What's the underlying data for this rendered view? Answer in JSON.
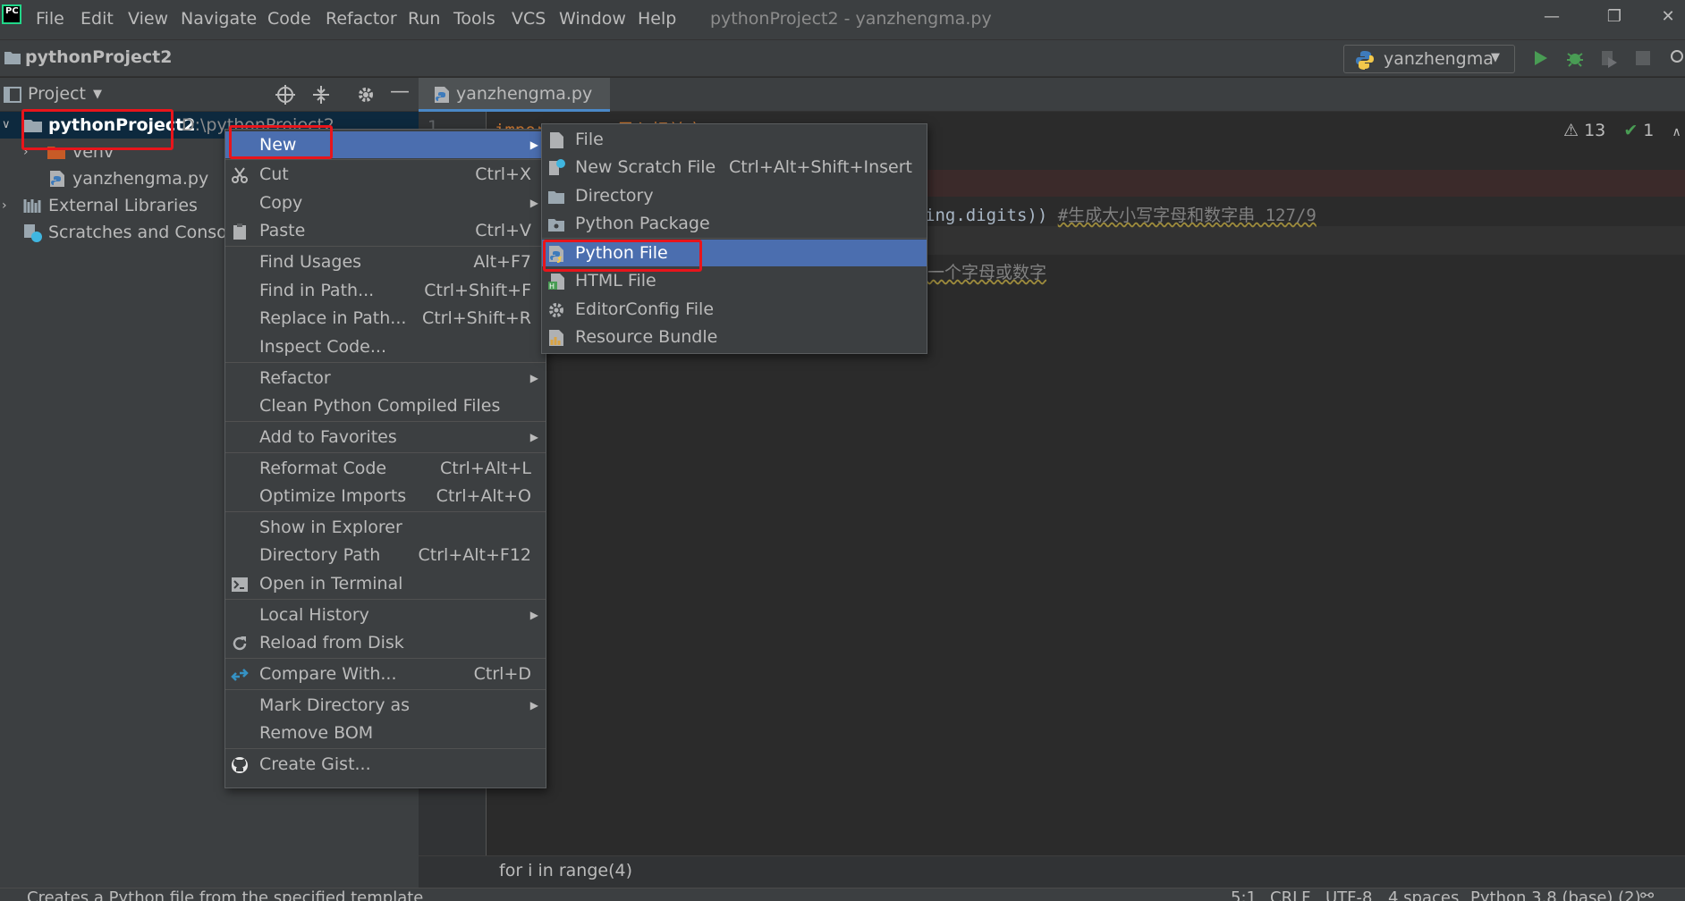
{
  "app": {
    "logo_text": "PC",
    "menu": [
      "File",
      "Edit",
      "View",
      "Navigate",
      "Code",
      "Refactor",
      "Run",
      "Tools",
      "VCS",
      "Window",
      "Help"
    ],
    "window_title": "pythonProject2 - yanzhengma.py"
  },
  "navbar": {
    "project": "pythonProject2",
    "run_config": "yanzhengma"
  },
  "project_panel": {
    "title": "Project",
    "tree": [
      {
        "label": "pythonProject2",
        "path": "D:\\pythonProject2"
      },
      {
        "label": "venv"
      },
      {
        "label": "yanzhengma.py"
      },
      {
        "label": "External Libraries"
      },
      {
        "label": "Scratches and Consoles"
      }
    ]
  },
  "editor": {
    "tab": "yanzhengma.py",
    "line_number": "1",
    "warnings": "13",
    "checks": "1",
    "line1": "import  ...  #导入相关库",
    "line3_code": "ing.digits)) ",
    "line3_comment": "#生成大小写字母和数字串  127/9",
    "line5_comment": "一个字母或数字",
    "breadcrumb": "for i in range(4)"
  },
  "context_menu": {
    "items": [
      {
        "label": "New",
        "shortcut": "",
        "submenu": true,
        "icon": ""
      },
      {
        "label": "Cut",
        "shortcut": "Ctrl+X",
        "icon": "scissors-icon"
      },
      {
        "label": "Copy",
        "shortcut": "",
        "submenu": true,
        "icon": ""
      },
      {
        "label": "Paste",
        "shortcut": "Ctrl+V",
        "icon": "clipboard-icon"
      },
      {
        "label": "Find Usages",
        "shortcut": "Alt+F7"
      },
      {
        "label": "Find in Path...",
        "shortcut": "Ctrl+Shift+F"
      },
      {
        "label": "Replace in Path...",
        "shortcut": "Ctrl+Shift+R"
      },
      {
        "label": "Inspect Code...",
        "shortcut": ""
      },
      {
        "label": "Refactor",
        "shortcut": "",
        "submenu": true
      },
      {
        "label": "Clean Python Compiled Files",
        "shortcut": ""
      },
      {
        "label": "Add to Favorites",
        "shortcut": "",
        "submenu": true
      },
      {
        "label": "Reformat Code",
        "shortcut": "Ctrl+Alt+L"
      },
      {
        "label": "Optimize Imports",
        "shortcut": "Ctrl+Alt+O"
      },
      {
        "label": "Show in Explorer",
        "shortcut": ""
      },
      {
        "label": "Directory Path",
        "shortcut": "Ctrl+Alt+F12"
      },
      {
        "label": "Open in Terminal",
        "shortcut": "",
        "icon": "terminal-icon"
      },
      {
        "label": "Local History",
        "shortcut": "",
        "submenu": true
      },
      {
        "label": "Reload from Disk",
        "shortcut": "",
        "icon": "reload-icon"
      },
      {
        "label": "Compare With...",
        "shortcut": "Ctrl+D",
        "icon": "compare-icon"
      },
      {
        "label": "Mark Directory as",
        "shortcut": "",
        "submenu": true
      },
      {
        "label": "Remove BOM",
        "shortcut": ""
      },
      {
        "label": "Create Gist...",
        "shortcut": "",
        "icon": "github-icon"
      }
    ]
  },
  "new_submenu": {
    "items": [
      {
        "label": "File",
        "shortcut": ""
      },
      {
        "label": "New Scratch File",
        "shortcut": "Ctrl+Alt+Shift+Insert"
      },
      {
        "label": "Directory",
        "shortcut": ""
      },
      {
        "label": "Python Package",
        "shortcut": ""
      },
      {
        "label": "Python File",
        "shortcut": "",
        "selected": true
      },
      {
        "label": "HTML File",
        "shortcut": ""
      },
      {
        "label": "EditorConfig File",
        "shortcut": ""
      },
      {
        "label": "Resource Bundle",
        "shortcut": ""
      }
    ]
  },
  "status": {
    "message": "Creates a Python file from the specified template",
    "position": "5:1",
    "line_sep": "CRLF",
    "encoding": "UTF-8",
    "indent": "4 spaces",
    "interpreter": "Python 3.8 (base) (2)"
  },
  "colors": {
    "menu_bg": "#3c3f41",
    "editor_bg": "#2b2b2b",
    "selection": "#4b6eaf",
    "annotation_red": "#e8151b"
  }
}
